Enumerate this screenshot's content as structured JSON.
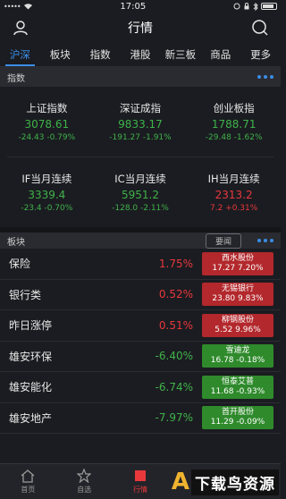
{
  "status": {
    "time": "17:05",
    "signal": "•••••"
  },
  "header": {
    "title": "行情"
  },
  "tabs": [
    {
      "label": "沪深"
    },
    {
      "label": "板块"
    },
    {
      "label": "指数"
    },
    {
      "label": "港股"
    },
    {
      "label": "新三板"
    },
    {
      "label": "商品"
    },
    {
      "label": "更多"
    }
  ],
  "index_section": {
    "title": "指数",
    "items": [
      {
        "name": "上证指数",
        "value": "3078.61",
        "change": "-24.43 -0.79%",
        "trend": "down"
      },
      {
        "name": "深证成指",
        "value": "9833.17",
        "change": "-191.27 -1.91%",
        "trend": "down"
      },
      {
        "name": "创业板指",
        "value": "1788.71",
        "change": "-29.48 -1.62%",
        "trend": "down"
      },
      {
        "name": "IF当月连续",
        "value": "3339.4",
        "change": "-23.4 -0.70%",
        "trend": "down"
      },
      {
        "name": "IC当月连续",
        "value": "5951.2",
        "change": "-128.0 -2.11%",
        "trend": "down"
      },
      {
        "name": "IH当月连续",
        "value": "2313.2",
        "change": "7.2 +0.31%",
        "trend": "up"
      }
    ]
  },
  "sector_section": {
    "title": "板块",
    "sort_label": "要闻",
    "rows": [
      {
        "name": "保险",
        "pct": "1.75%",
        "trend": "up",
        "stock": "西水股份",
        "stock_info": "17.27 7.20%"
      },
      {
        "name": "银行类",
        "pct": "0.52%",
        "trend": "up",
        "stock": "无锡银行",
        "stock_info": "23.80 9.83%"
      },
      {
        "name": "昨日涨停",
        "pct": "0.51%",
        "trend": "up",
        "stock": "柳钢股份",
        "stock_info": "5.52 9.96%"
      },
      {
        "name": "雄安环保",
        "pct": "-6.40%",
        "trend": "down",
        "stock": "雪迪龙",
        "stock_info": "16.78 -0.18%"
      },
      {
        "name": "雄安能化",
        "pct": "-6.74%",
        "trend": "down",
        "stock": "恒泰艾普",
        "stock_info": "11.68 -0.93%"
      },
      {
        "name": "雄安地产",
        "pct": "-7.97%",
        "trend": "down",
        "stock": "首开股份",
        "stock_info": "11.29 -0.09%"
      }
    ]
  },
  "tabbar": [
    {
      "label": "首页",
      "icon": "home-icon"
    },
    {
      "label": "自选",
      "icon": "star-icon"
    },
    {
      "label": "行情",
      "icon": "market-icon"
    }
  ],
  "watermark": {
    "text": "下载鸟资源"
  },
  "colors": {
    "accent": "#3a8ee6",
    "up": "#e8383c",
    "down": "#3fb24a"
  }
}
